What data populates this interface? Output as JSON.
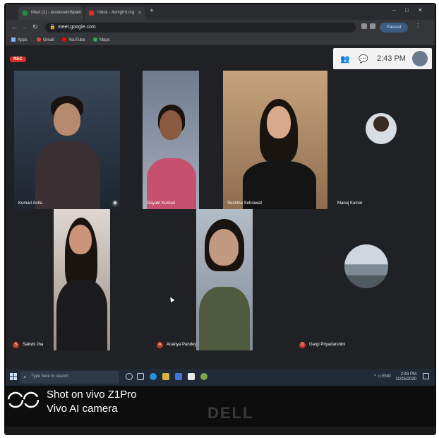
{
  "browser": {
    "tabs": [
      {
        "label": "Meet (2) - iwuxeoetmfqiem"
      },
      {
        "label": "Inbox - 4urvgtrtr.org"
      }
    ],
    "url": "meet.google.com",
    "profile_label": "Paused",
    "bookmarks": [
      "Apps",
      "Gmail",
      "YouTube",
      "Maps"
    ]
  },
  "meet": {
    "recording_label": "REC",
    "time": "2:43 PM",
    "participants": [
      {
        "name": "Kumari Anita"
      },
      {
        "name": "Gayatri Kumari"
      },
      {
        "name": "Sushma Sehrawat"
      },
      {
        "name": "Manoj Kumar"
      },
      {
        "name": "Sakshi Jha",
        "initial": "S"
      },
      {
        "name": "Ananya Pandey",
        "initial": "A"
      },
      {
        "name": "Gargi Priyadarshini",
        "initial": "G"
      }
    ]
  },
  "taskbar": {
    "search_placeholder": "Type here to search",
    "tray_lang": "ENG",
    "tray_time": "2:43 PM",
    "tray_date": "11/25/2020"
  },
  "watermark": {
    "line1": "Shot on vivo Z1Pro",
    "line2": "Vivo AI camera"
  },
  "brand": "DELL"
}
